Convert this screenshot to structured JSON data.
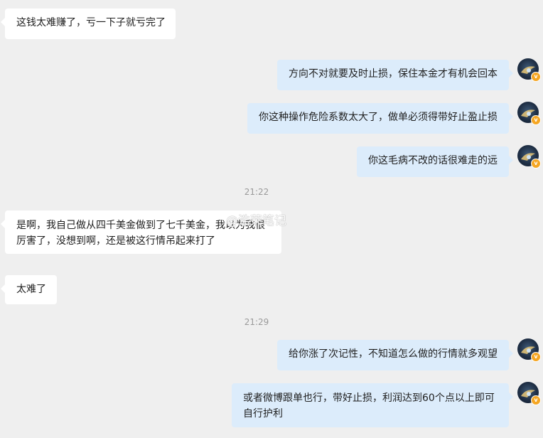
{
  "messages": [
    {
      "dir": "in",
      "text": "这钱太难赚了，亏一下子就亏完了"
    },
    {
      "dir": "out",
      "text": "方向不对就要及时止损，保住本金才有机会回本"
    },
    {
      "dir": "out",
      "text": "你这种操作危险系数太大了，做单必须得带好止盈止损"
    },
    {
      "dir": "out",
      "text": "你这毛病不改的话很难走的远"
    },
    {
      "dir": "in",
      "text": "是啊，我自己做从四千美金做到了七千美金，我以为我很厉害了，没想到啊，还是被这行情吊起来打了"
    },
    {
      "dir": "in",
      "text": "太难了"
    },
    {
      "dir": "out",
      "text": "给你涨了次记性，不知道怎么做的行情就多观望"
    },
    {
      "dir": "out",
      "text": "或者微博跟单也行，带好止损，利润达到60个点以上即可自行护利"
    }
  ],
  "timestamps": [
    "21:22",
    "21:29"
  ],
  "watermark": "@浩荣笔记",
  "avatar": {
    "icon": "user-avatar-icon",
    "badge": "v",
    "badge_color": "#f5a623"
  },
  "colors": {
    "background": "#efefef",
    "incoming": "#ffffff",
    "outgoing": "#dcecfb"
  }
}
